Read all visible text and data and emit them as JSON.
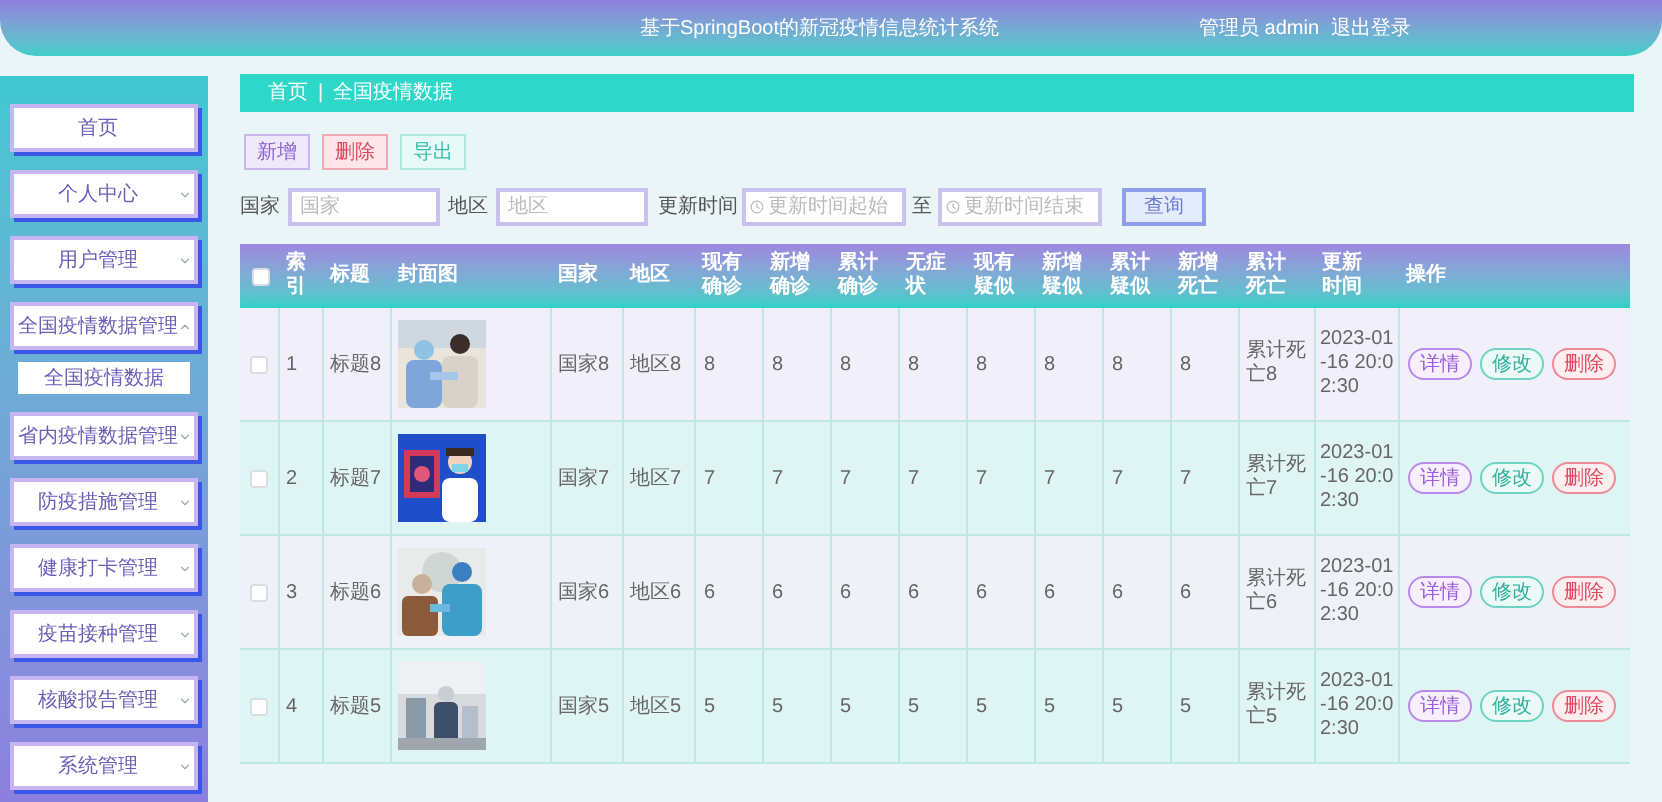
{
  "header": {
    "title": "基于SpringBoot的新冠疫情信息统计系统",
    "user": "管理员 admin",
    "logout": "退出登录"
  },
  "sidebar": {
    "items": [
      {
        "label": "首页",
        "kind": "link"
      },
      {
        "label": "个人中心",
        "kind": "menu",
        "expanded": false
      },
      {
        "label": "用户管理",
        "kind": "menu",
        "expanded": false
      },
      {
        "label": "全国疫情数据管理",
        "kind": "menu",
        "expanded": true,
        "children": [
          {
            "label": "全国疫情数据",
            "selected": true
          }
        ]
      },
      {
        "label": "省内疫情数据管理",
        "kind": "menu",
        "expanded": false
      },
      {
        "label": "防疫措施管理",
        "kind": "menu",
        "expanded": false
      },
      {
        "label": "健康打卡管理",
        "kind": "menu",
        "expanded": false
      },
      {
        "label": "疫苗接种管理",
        "kind": "menu",
        "expanded": false
      },
      {
        "label": "核酸报告管理",
        "kind": "menu",
        "expanded": false
      },
      {
        "label": "系统管理",
        "kind": "menu",
        "expanded": false
      }
    ]
  },
  "breadcrumb": [
    "首页",
    "全国疫情数据"
  ],
  "breadcrumb_separator": "|",
  "actions": [
    {
      "label": "新增",
      "kind": "add"
    },
    {
      "label": "删除",
      "kind": "delete"
    },
    {
      "label": "导出",
      "kind": "export"
    }
  ],
  "search": {
    "country": {
      "label": "国家",
      "placeholder": "国家"
    },
    "region": {
      "label": "地区",
      "placeholder": "地区"
    },
    "time": {
      "label": "更新时间",
      "start_placeholder": "更新时间起始",
      "to": "至",
      "end_placeholder": "更新时间结束"
    },
    "button": "查询"
  },
  "table": {
    "select_all_checked": false,
    "columns": [
      "索引",
      "标题",
      "封面图",
      "国家",
      "地区",
      "现有确诊",
      "新增确诊",
      "累计确诊",
      "无症状",
      "现有疑似",
      "新增疑似",
      "累计疑似",
      "新增死亡",
      "累计死亡",
      "更新时间",
      "操作"
    ],
    "rows": [
      {
        "checked": false,
        "index": "1",
        "title": "标题8",
        "cover": {
          "kind": "picture"
        },
        "country": "国家8",
        "region": "地区8",
        "values": [
          "8",
          "8",
          "8",
          "8",
          "8",
          "8",
          "8",
          "8"
        ],
        "deaths": "累计死亡8",
        "time": "2023-01-16 20:02:30",
        "ops": [
          "详情",
          "修改",
          "删除"
        ]
      },
      {
        "checked": false,
        "index": "2",
        "title": "标题7",
        "cover": {
          "kind": "picture"
        },
        "country": "国家7",
        "region": "地区7",
        "values": [
          "7",
          "7",
          "7",
          "7",
          "7",
          "7",
          "7",
          "7"
        ],
        "deaths": "累计死亡7",
        "time": "2023-01-16 20:02:30",
        "ops": [
          "详情",
          "修改",
          "删除"
        ]
      },
      {
        "checked": false,
        "index": "3",
        "title": "标题6",
        "cover": {
          "kind": "picture"
        },
        "country": "国家6",
        "region": "地区6",
        "values": [
          "6",
          "6",
          "6",
          "6",
          "6",
          "6",
          "6",
          "6"
        ],
        "deaths": "累计死亡6",
        "time": "2023-01-16 20:02:30",
        "ops": [
          "详情",
          "修改",
          "删除"
        ]
      },
      {
        "checked": false,
        "index": "4",
        "title": "标题5",
        "cover": {
          "kind": "picture"
        },
        "country": "国家5",
        "region": "地区5",
        "values": [
          "5",
          "5",
          "5",
          "5",
          "5",
          "5",
          "5",
          "5"
        ],
        "deaths": "累计死亡5",
        "time": "2023-01-16 20:02:30",
        "ops": [
          "详情",
          "修改",
          "删除"
        ]
      }
    ]
  }
}
